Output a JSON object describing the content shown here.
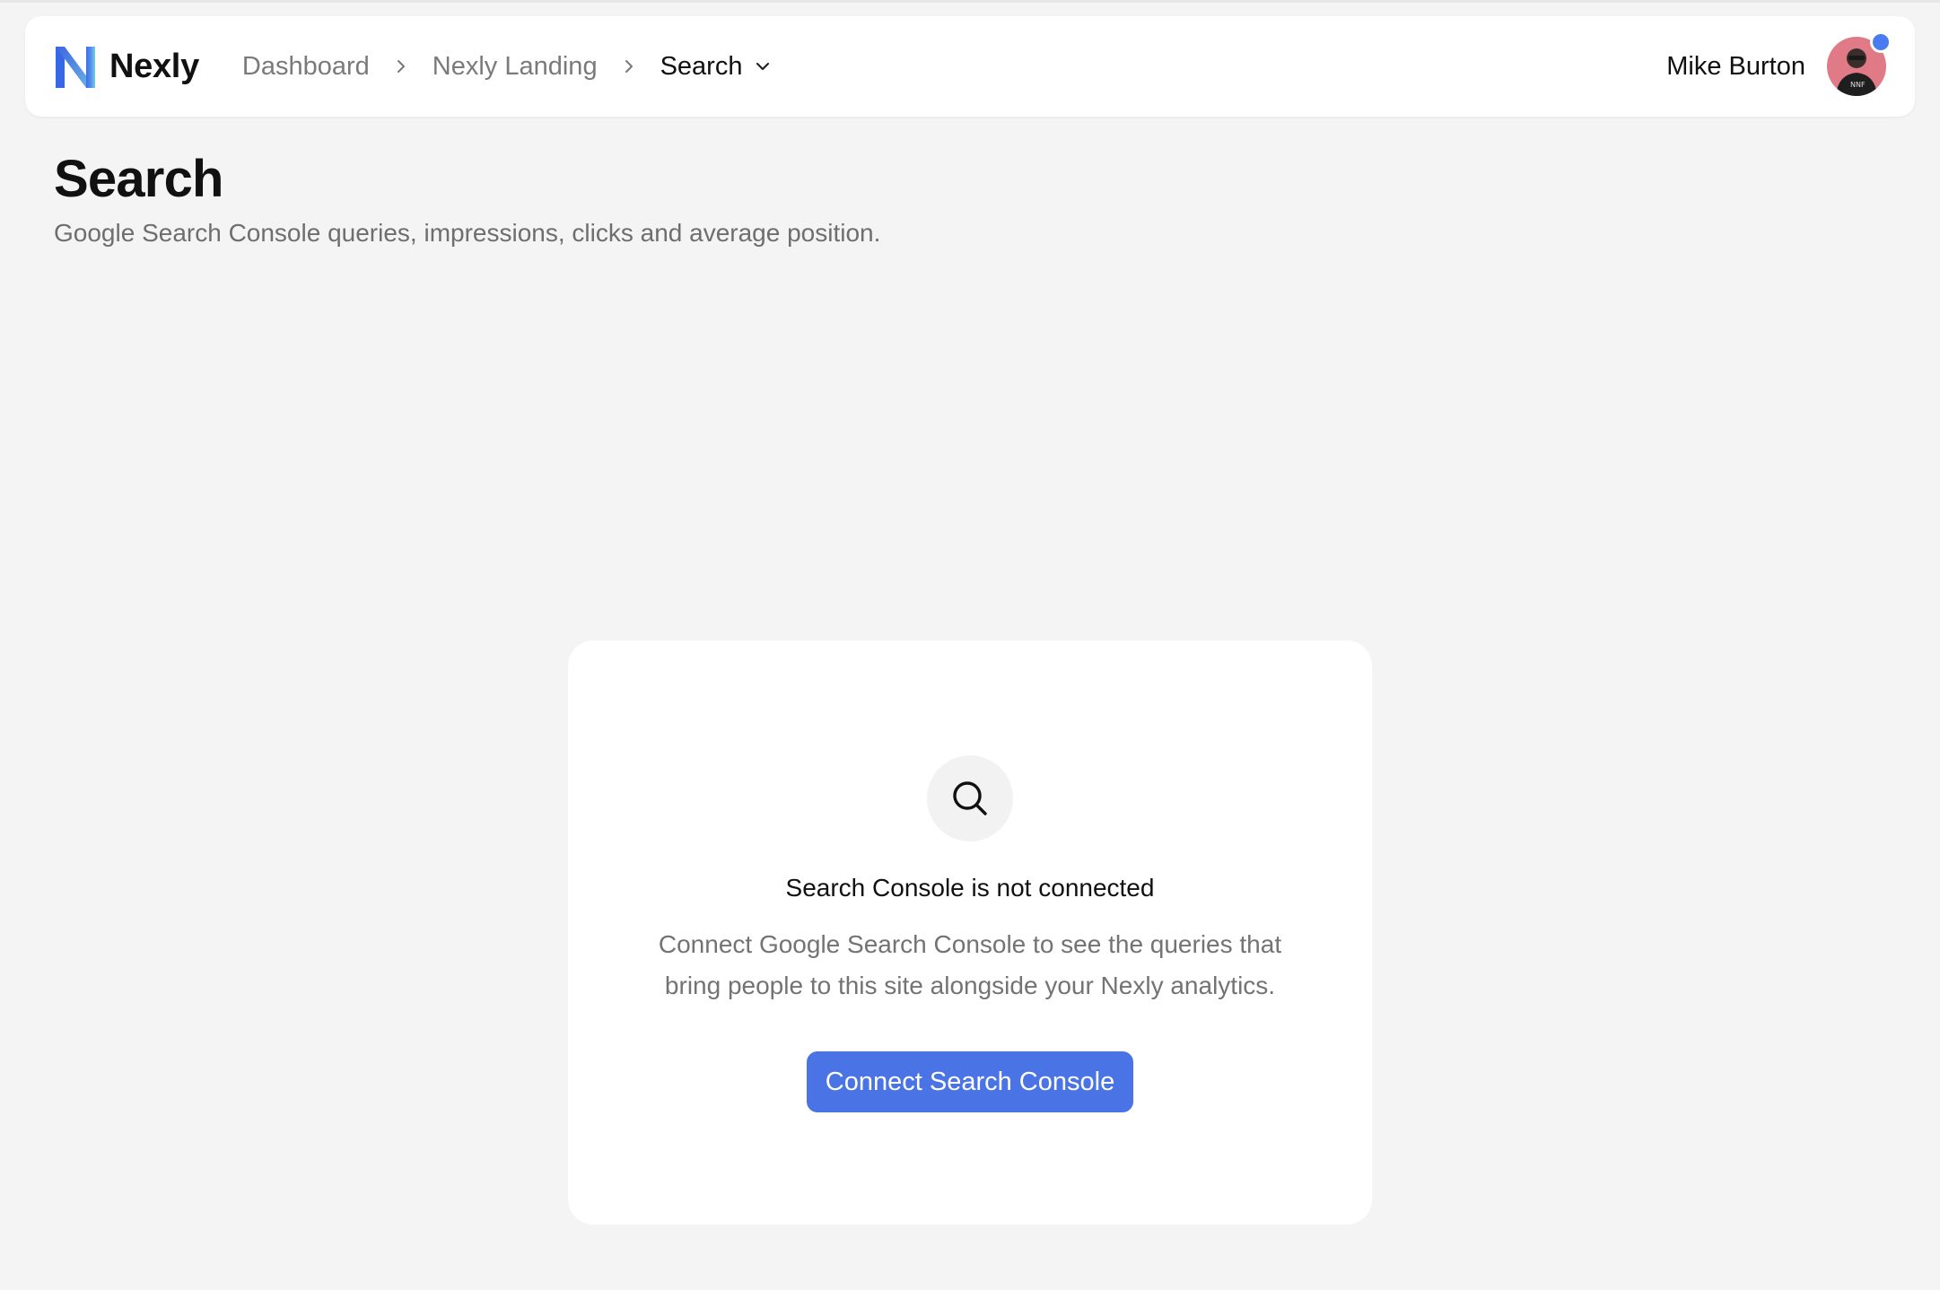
{
  "app": {
    "name": "Nexly"
  },
  "breadcrumb": {
    "items": [
      {
        "label": "Dashboard"
      },
      {
        "label": "Nexly Landing"
      }
    ],
    "current": "Search"
  },
  "user": {
    "name": "Mike Burton",
    "online_color": "#4a7bf0"
  },
  "page": {
    "title": "Search",
    "subtitle": "Google Search Console queries, impressions, clicks and average position."
  },
  "empty_state": {
    "icon": "search-icon",
    "title": "Search Console is not connected",
    "description": "Connect Google Search Console to see the queries that bring people to this site alongside your Nexly analytics.",
    "button_label": "Connect Search Console"
  },
  "colors": {
    "accent": "#4a74e6",
    "background": "#f4f4f4"
  }
}
